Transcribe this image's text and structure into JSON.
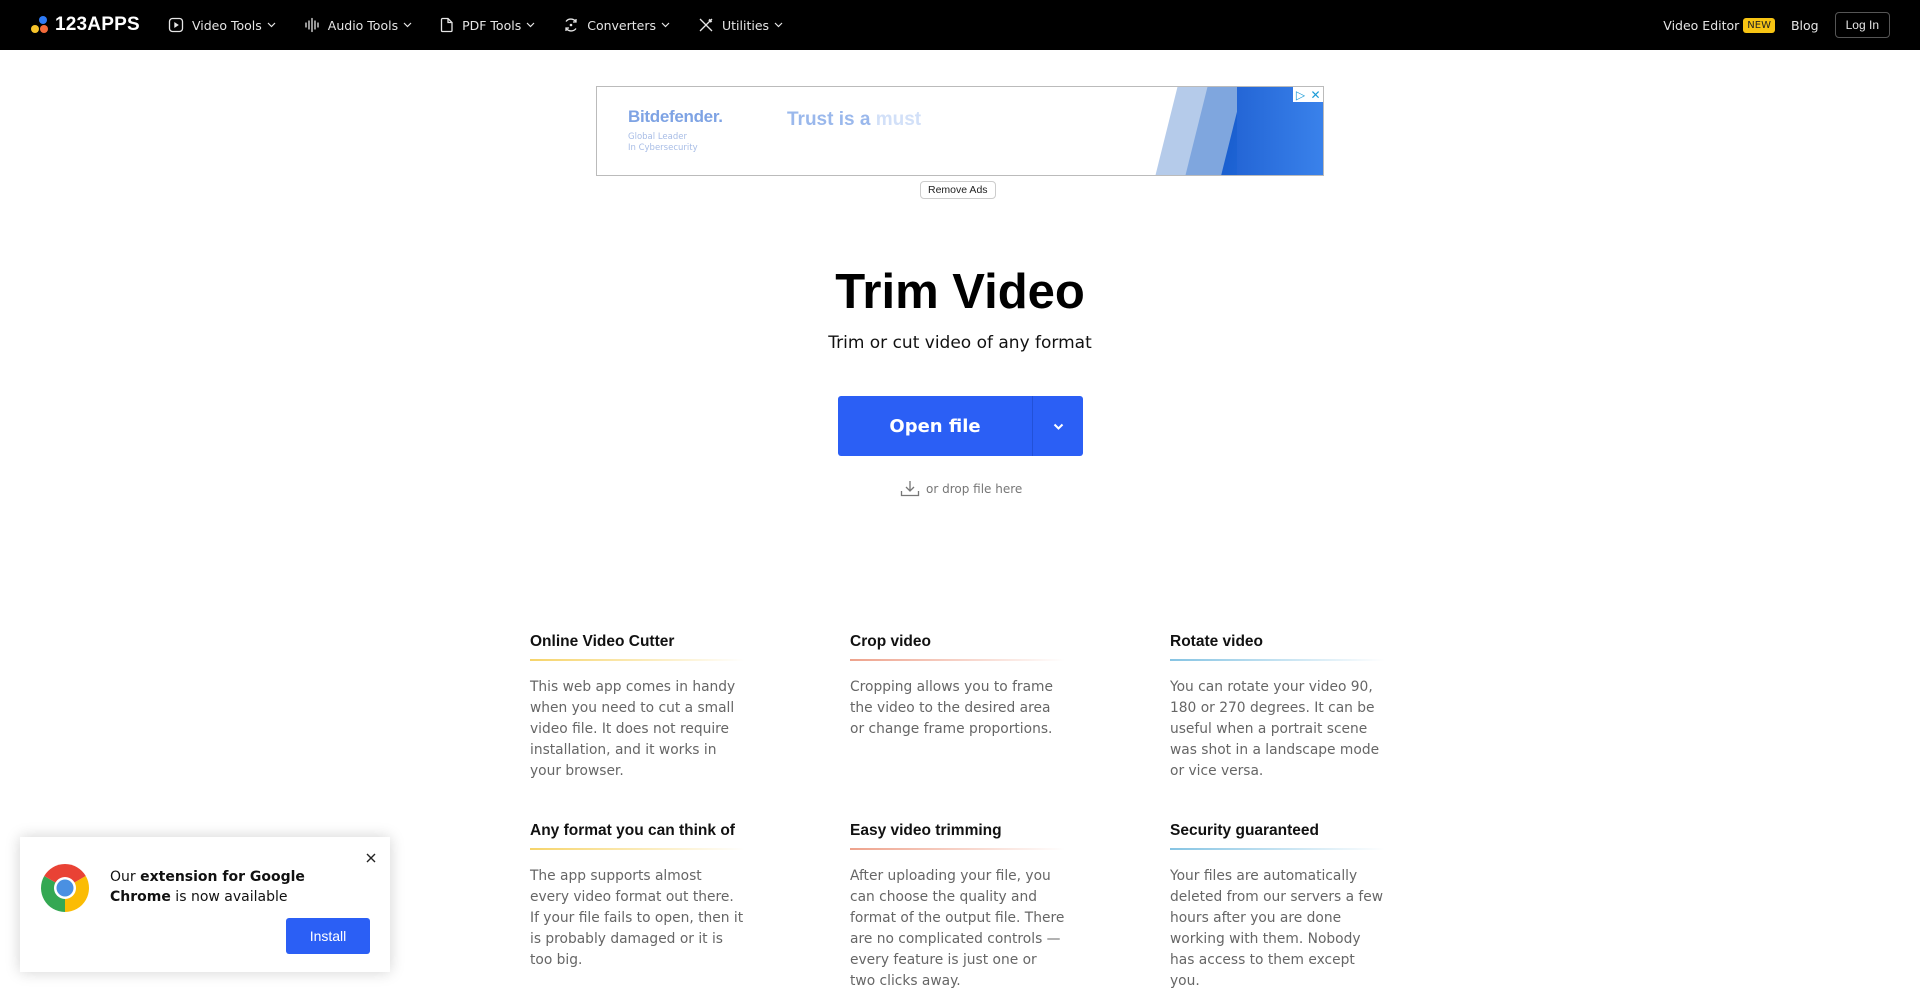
{
  "header": {
    "logo_text": "123APPS",
    "nav": [
      {
        "label": "Video Tools",
        "icon": "play-square-icon"
      },
      {
        "label": "Audio Tools",
        "icon": "audio-wave-icon"
      },
      {
        "label": "PDF Tools",
        "icon": "document-icon"
      },
      {
        "label": "Converters",
        "icon": "convert-cycle-icon"
      },
      {
        "label": "Utilities",
        "icon": "tools-icon"
      }
    ],
    "video_editor_label": "Video Editor",
    "new_badge": "NEW",
    "blog_label": "Blog",
    "login_label": "Log In"
  },
  "ad": {
    "brand": "Bitdefender.",
    "tagline_line1": "Global Leader",
    "tagline_line2": "In Cybersecurity",
    "headline_main": "Trust is a",
    "headline_faded": "must",
    "adchoices_glyph": "▷",
    "close_glyph": "✕",
    "remove_ads_label": "Remove Ads"
  },
  "hero": {
    "title": "Trim Video",
    "subtitle": "Trim or cut video of any format",
    "open_file_label": "Open file",
    "drop_hint": "or drop file here"
  },
  "features": [
    {
      "title": "Online Video Cutter",
      "text": "This web app comes in handy when you need to cut a small video file. It does not require installation, and it works in your browser.",
      "accent": "#f6d46a"
    },
    {
      "title": "Crop video",
      "text": "Cropping allows you to frame the video to the desired area or change frame proportions.",
      "accent": "#eea28c"
    },
    {
      "title": "Rotate video",
      "text": "You can rotate your video 90, 180 or 270 degrees. It can be useful when a portrait scene was shot in a landscape mode or vice versa.",
      "accent": "#86c4e3"
    },
    {
      "title": "Any format you can think of",
      "text": "The app supports almost every video format out there. If your file fails to open, then it is probably damaged or it is too big.",
      "accent": "#f6d46a"
    },
    {
      "title": "Easy video trimming",
      "text": "After uploading your file, you can choose the quality and format of the output file. There are no complicated controls — every feature is just one or two clicks away.",
      "accent": "#eea28c"
    },
    {
      "title": "Security guaranteed",
      "text": "Your files are automatically deleted from our servers a few hours after you are done working with them. Nobody has access to them except you.",
      "accent": "#86c4e3"
    }
  ],
  "chrome_popup": {
    "text_prefix": "Our ",
    "text_bold": "extension for Google Chrome",
    "text_suffix": " is now available",
    "install_label": "Install"
  },
  "colors": {
    "primary": "#2b5ff5",
    "header_bg": "#000000",
    "new_badge": "#f7c413"
  }
}
